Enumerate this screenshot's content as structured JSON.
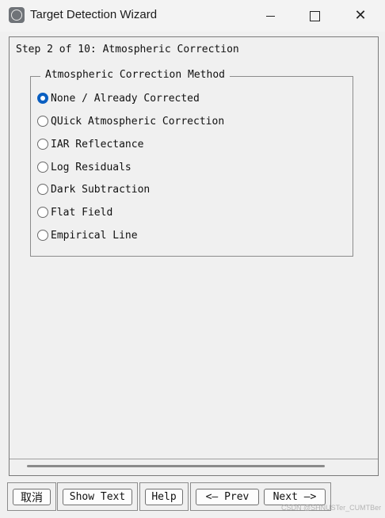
{
  "window": {
    "title": "Target Detection Wizard",
    "minimize_glyph": "",
    "close_glyph": "✕"
  },
  "wizard": {
    "step_label": "Step 2 of 10: Atmospheric Correction",
    "group_title": "Atmospheric Correction Method",
    "options": [
      {
        "label": "None / Already Corrected",
        "checked": true
      },
      {
        "label": "QUick Atmospheric Correction",
        "checked": false
      },
      {
        "label": "IAR Reflectance",
        "checked": false
      },
      {
        "label": "Log Residuals",
        "checked": false
      },
      {
        "label": "Dark Subtraction",
        "checked": false
      },
      {
        "label": "Flat Field",
        "checked": false
      },
      {
        "label": "Empirical Line",
        "checked": false
      }
    ]
  },
  "buttons": {
    "cancel": "取消",
    "show_text": "Show Text",
    "help": "Help",
    "prev": "<— Prev",
    "next": "Next —>"
  },
  "watermark": "CSDN @SHNUSTer_CUMTBer",
  "colors": {
    "accent": "#0a5fc1",
    "background": "#f0f0f0"
  }
}
